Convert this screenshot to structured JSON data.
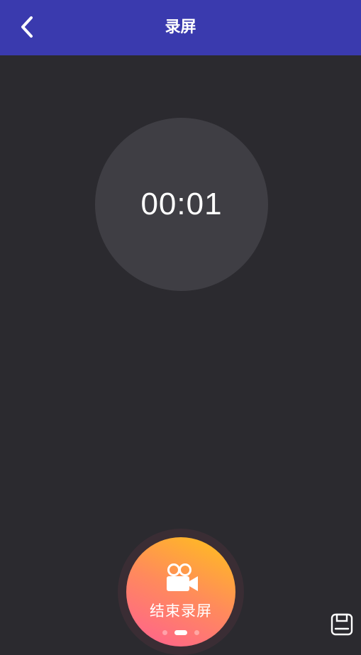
{
  "header": {
    "title": "录屏",
    "back_icon": "chevron-left-icon",
    "background": "#3a3aae"
  },
  "timer": {
    "elapsed": "00:01"
  },
  "record_button": {
    "label": "结束录屏",
    "icon": "video-camera-icon",
    "gradient_colors": [
      "#ff5f92",
      "#ff8a5c",
      "#ffc21a"
    ],
    "pager_dots": 3,
    "active_dot": 1
  },
  "corner_button": {
    "icon": "save-icon"
  }
}
